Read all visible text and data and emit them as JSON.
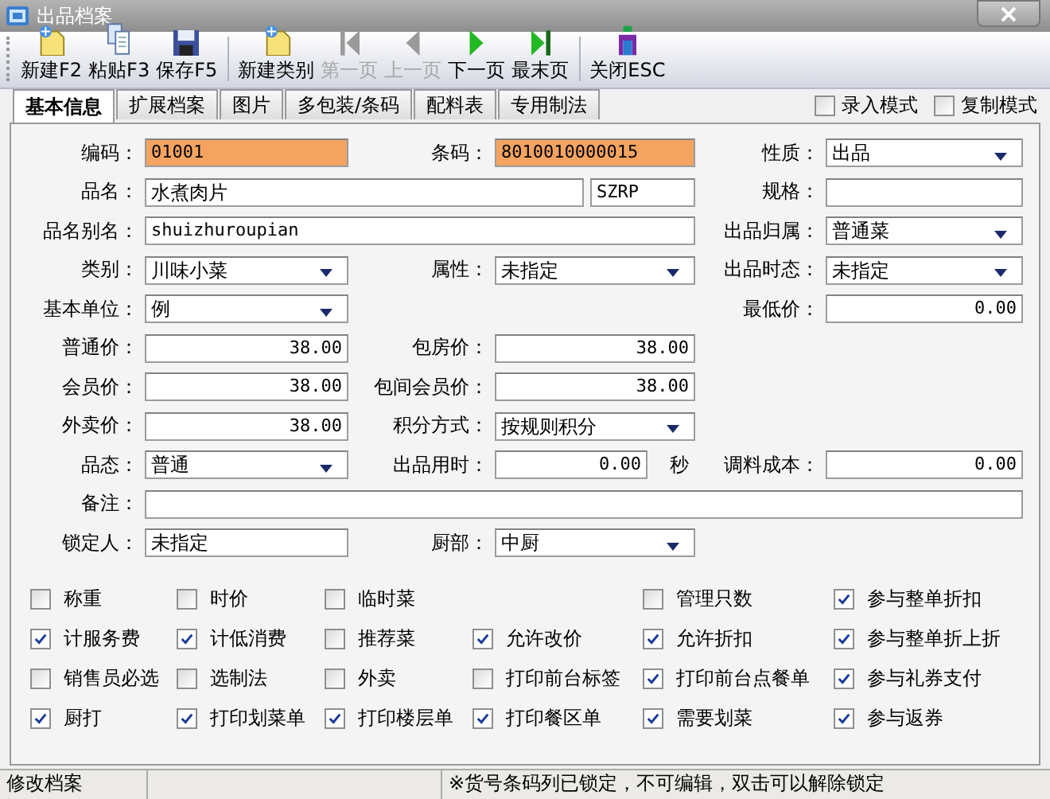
{
  "window": {
    "title": "出品档案"
  },
  "toolbar_groups": [
    [
      {
        "label": "新建F2",
        "disabled": false
      },
      {
        "label": "粘贴F3",
        "disabled": false
      },
      {
        "label": "保存F5",
        "disabled": false
      }
    ],
    [
      {
        "label": "新建类别",
        "disabled": false
      },
      {
        "label": "第一页",
        "disabled": true
      },
      {
        "label": "上一页",
        "disabled": true
      },
      {
        "label": "下一页",
        "disabled": false
      },
      {
        "label": "最末页",
        "disabled": false
      }
    ],
    [
      {
        "label": "关闭ESC",
        "disabled": false
      }
    ]
  ],
  "tabs": [
    {
      "label": "基本信息",
      "selected": true
    },
    {
      "label": "扩展档案",
      "selected": false
    },
    {
      "label": "图片",
      "selected": false
    },
    {
      "label": "多包装/条码",
      "selected": false
    },
    {
      "label": "配料表",
      "selected": false
    },
    {
      "label": "专用制法",
      "selected": false
    }
  ],
  "modes": [
    {
      "label": "录入模式",
      "checked": false
    },
    {
      "label": "复制模式",
      "checked": false
    }
  ],
  "fields": [
    {
      "label": "编码：",
      "value": "01001",
      "kind": "text",
      "highlighted": true
    },
    {
      "label": "条码：",
      "value": "8010010000015",
      "kind": "text",
      "highlighted": true
    },
    {
      "label": "性质：",
      "value": "出品",
      "kind": "dropdown",
      "highlighted": false
    },
    {
      "label": "品名：",
      "value": "水煮肉片",
      "kind": "text",
      "highlighted": false
    },
    {
      "value": "SZRP",
      "kind": "text",
      "highlighted": false
    },
    {
      "label": "规格：",
      "kind": "text",
      "highlighted": false
    },
    {
      "label": "品名别名：",
      "value": "shuizhuroupian",
      "kind": "text",
      "highlighted": false
    },
    {
      "label": "出品归属：",
      "value": "普通菜",
      "kind": "dropdown",
      "highlighted": false
    },
    {
      "label": "类别：",
      "value": "川味小菜",
      "kind": "dropdown",
      "highlighted": false
    },
    {
      "label": "属性：",
      "value": "未指定",
      "kind": "dropdown",
      "highlighted": false
    },
    {
      "label": "出品时态：",
      "value": "未指定",
      "kind": "dropdown",
      "highlighted": false
    },
    {
      "label": "基本单位：",
      "value": "例",
      "kind": "dropdown",
      "highlighted": false
    },
    {
      "label": "最低价：",
      "value": "0.00",
      "kind": "number",
      "highlighted": false
    },
    {
      "label": "普通价：",
      "value": "38.00",
      "kind": "number",
      "highlighted": false
    },
    {
      "label": "包房价：",
      "value": "38.00",
      "kind": "number",
      "highlighted": false
    },
    {
      "label": "会员价：",
      "value": "38.00",
      "kind": "number",
      "highlighted": false
    },
    {
      "label": "包间会员价：",
      "value": "38.00",
      "kind": "number",
      "highlighted": false
    },
    {
      "label": "外卖价：",
      "value": "38.00",
      "kind": "number",
      "highlighted": false
    },
    {
      "label": "积分方式：",
      "value": "按规则积分",
      "kind": "dropdown",
      "highlighted": false
    },
    {
      "label": "品态：",
      "value": "普通",
      "kind": "dropdown",
      "highlighted": false
    },
    {
      "label": "出品用时：",
      "value": "0.00",
      "kind": "number",
      "unit": "秒",
      "highlighted": false
    },
    {
      "label": "调料成本：",
      "value": "0.00",
      "kind": "number",
      "highlighted": false
    },
    {
      "label": "备注：",
      "kind": "text",
      "highlighted": false
    },
    {
      "label": "锁定人：",
      "value": "未指定",
      "kind": "text",
      "highlighted": false
    },
    {
      "label": "厨部：",
      "value": "中厨",
      "kind": "dropdown",
      "highlighted": false
    }
  ],
  "option_columns": [
    [
      {
        "label": "称重",
        "checked": false
      },
      {
        "label": "计服务费",
        "checked": true
      },
      {
        "label": "销售员必选",
        "checked": false
      },
      {
        "label": "厨打",
        "checked": true
      }
    ],
    [
      {
        "label": "时价",
        "checked": false
      },
      {
        "label": "计低消费",
        "checked": true
      },
      {
        "label": "选制法",
        "checked": false
      },
      {
        "label": "打印划菜单",
        "checked": true
      }
    ],
    [
      {
        "label": "临时菜",
        "checked": false
      },
      {
        "label": "推荐菜",
        "checked": false
      },
      {
        "label": "外卖",
        "checked": false
      },
      {
        "label": "打印楼层单",
        "checked": true
      }
    ],
    [
      {
        "label": "允许改价",
        "checked": true
      },
      {
        "label": "打印前台标签",
        "checked": false
      },
      {
        "label": "打印餐区单",
        "checked": true
      }
    ],
    [
      {
        "label": "管理只数",
        "checked": false
      },
      {
        "label": "允许折扣",
        "checked": true
      },
      {
        "label": "打印前台点餐单",
        "checked": true
      },
      {
        "label": "需要划菜",
        "checked": true
      }
    ],
    [
      {
        "label": "参与整单折扣",
        "checked": true
      },
      {
        "label": "参与整单折上折",
        "checked": true
      },
      {
        "label": "参与礼券支付",
        "checked": true
      },
      {
        "label": "参与返券",
        "checked": true
      }
    ]
  ],
  "status_bar": [
    {
      "text": "修改档案"
    },
    {
      "text": "※货号条码列已锁定，不可编辑，双击可以解除锁定"
    }
  ]
}
